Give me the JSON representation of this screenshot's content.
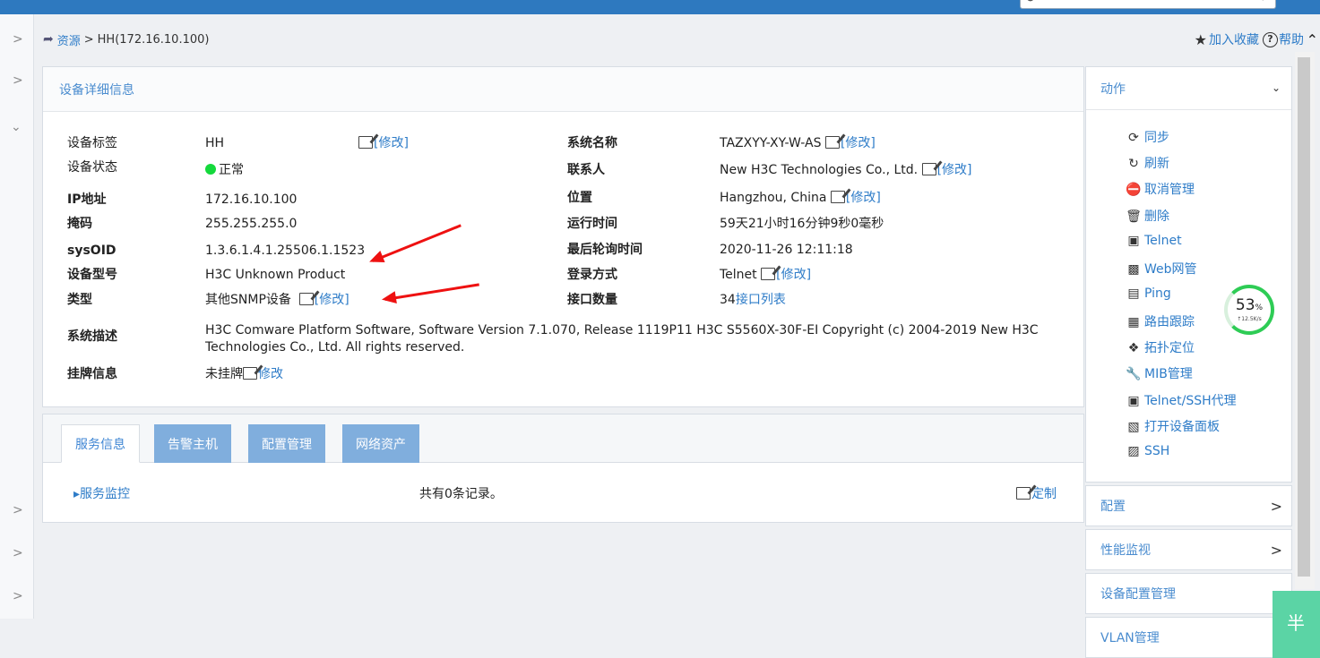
{
  "breadcrumb": {
    "root": "资源",
    "sep": ">",
    "current": "HH(172.16.10.100)"
  },
  "topright": {
    "favorite": "加入收藏",
    "help": "帮助"
  },
  "info_panel": {
    "title": "设备详细信息",
    "left_rows": [
      {
        "label": "设备标签",
        "value": "HH",
        "edit": "[修改]"
      },
      {
        "label": "设备状态",
        "value": "正常"
      },
      {
        "label": "IP地址",
        "value": "172.16.10.100"
      },
      {
        "label": "掩码",
        "value": "255.255.255.0"
      },
      {
        "label": "sysOID",
        "value": "1.3.6.1.4.1.25506.1.1523"
      },
      {
        "label": "设备型号",
        "value": "H3C Unknown Product"
      },
      {
        "label": "类型",
        "value": "其他SNMP设备",
        "edit": "[修改]"
      }
    ],
    "right_rows": [
      {
        "label": "系统名称",
        "value": "TAZXYY-XY-W-AS",
        "edit": "[修改]"
      },
      {
        "label": "联系人",
        "value": "New H3C Technologies Co., Ltd.",
        "edit": "[修改]"
      },
      {
        "label": "位置",
        "value": "Hangzhou, China",
        "edit": "[修改]"
      },
      {
        "label": "运行时间",
        "value": "59天21小时16分钟9秒0毫秒"
      },
      {
        "label": "最后轮询时间",
        "value": "2020-11-26 12:11:18"
      },
      {
        "label": "登录方式",
        "value": "Telnet",
        "edit": "[修改]"
      },
      {
        "label": "接口数量",
        "value": "34",
        "link": "接口列表"
      }
    ],
    "sysdesc_label": "系统描述",
    "sysdesc_line1": "H3C Comware Platform Software, Software Version 7.1.070, Release 1119P11 H3C S5560X-30F-EI Copyright (c) 2004-2019 New H3C",
    "sysdesc_line2": "Technologies Co., Ltd. All rights reserved.",
    "tag_label": "挂牌信息",
    "tag_value": "未挂牌",
    "tag_edit": "修改"
  },
  "tabs": [
    "服务信息",
    "告警主机",
    "配置管理",
    "网络资产"
  ],
  "service": {
    "monitor": "▸服务监控",
    "records": "共有0条记录。",
    "customize": "定制"
  },
  "actions": {
    "title": "动作",
    "items": [
      {
        "icon": "sync-icon",
        "label": "同步"
      },
      {
        "icon": "refresh-icon",
        "label": "刷新"
      },
      {
        "icon": "unmanage-icon",
        "label": "取消管理"
      },
      {
        "icon": "trash-icon",
        "label": "删除"
      },
      {
        "icon": "telnet-icon",
        "label": "Telnet"
      },
      {
        "icon": "web-icon",
        "label": "Web网管"
      },
      {
        "icon": "ping-icon",
        "label": "Ping"
      },
      {
        "icon": "trace-icon",
        "label": "路由跟踪"
      },
      {
        "icon": "topology-icon",
        "label": "拓扑定位"
      },
      {
        "icon": "wrench-icon",
        "label": "MIB管理"
      },
      {
        "icon": "telnet-icon",
        "label": "Telnet/SSH代理"
      },
      {
        "icon": "panel-icon",
        "label": "打开设备面板"
      },
      {
        "icon": "ssh-icon",
        "label": "SSH"
      }
    ]
  },
  "side_sections": [
    "配置",
    "性能监视",
    "设备配置管理",
    "VLAN管理"
  ],
  "gauge": {
    "percent": "53",
    "unit": "%",
    "speed": "↑12.5K/s"
  },
  "floating": {
    "text": "半"
  },
  "colors": {
    "topbar": "#2e79bf",
    "link": "#2e7cc8",
    "status_ok": "#14d93c",
    "arrow": "#e11111"
  }
}
